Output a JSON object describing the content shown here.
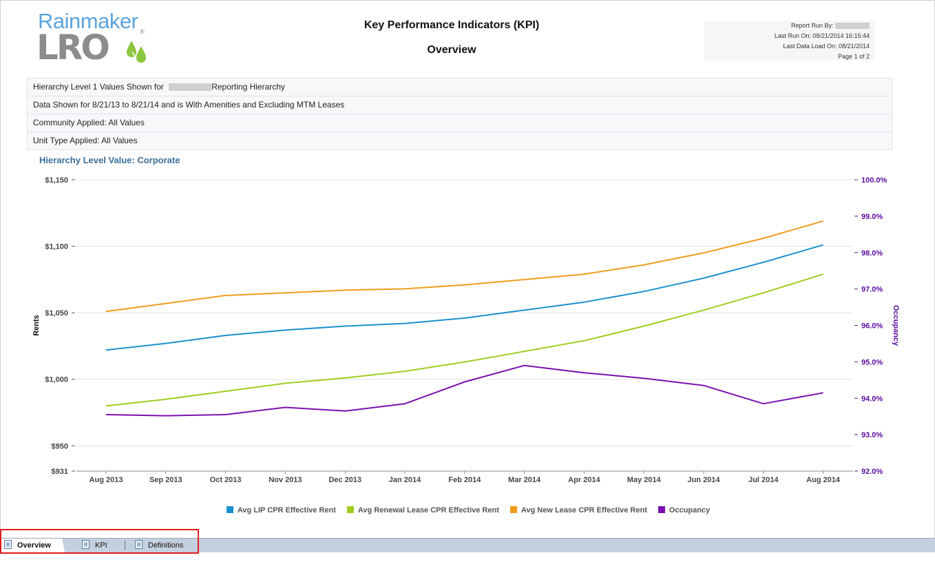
{
  "header": {
    "logo_top": "Rainmaker",
    "logo_bottom": "LRO",
    "logo_reg": "®",
    "title": "Key Performance Indicators (KPI)",
    "subtitle": "Overview",
    "report_run_by": "Report Run By:",
    "last_run_on": "Last Run On: 08/21/2014 16:15:44",
    "last_data_load": "Last Data Load On: 08/21/2014",
    "page": "Page 1 of 2"
  },
  "params": {
    "hierarchy_prefix": "Hierarchy Level 1 Values Shown for",
    "hierarchy_suffix": "Reporting Hierarchy",
    "data_shown": "Data Shown for 8/21/13 to 8/21/14 and is With Amenities and Excluding MTM Leases",
    "community": "Community Applied: All Values",
    "unit_type": "Unit Type Applied: All Values"
  },
  "hierarchy_value": "Hierarchy Level Value: Corporate",
  "chart_data": {
    "type": "line",
    "xlabel": "",
    "ylabel": "Rents",
    "y2label": "Occupancy",
    "categories": [
      "Aug 2013",
      "Sep 2013",
      "Oct 2013",
      "Nov 2013",
      "Dec 2013",
      "Jan 2014",
      "Feb 2014",
      "Mar 2014",
      "Apr 2014",
      "May 2014",
      "Jun 2014",
      "Jul 2014",
      "Aug 2014"
    ],
    "ylim": [
      931,
      1150
    ],
    "y_ticks": [
      931,
      950,
      1000,
      1050,
      1100,
      1150
    ],
    "y_tick_labels": [
      "$931",
      "$950",
      "$1,000",
      "$1,050",
      "$1,100",
      "$1,150"
    ],
    "y2lim": [
      92.0,
      100.0
    ],
    "y2_ticks": [
      92,
      93,
      94,
      95,
      96,
      97,
      98,
      99,
      100
    ],
    "y2_tick_labels": [
      "92.0%",
      "93.0%",
      "94.0%",
      "95.0%",
      "96.0%",
      "97.0%",
      "98.0%",
      "99.0%",
      "100.0%"
    ],
    "grid": true,
    "legend_position": "bottom",
    "series": [
      {
        "name": "Avg LIP CPR Effective Rent",
        "axis": "left",
        "color": "#1b8fce",
        "values": [
          1022,
          1027,
          1033,
          1037,
          1040,
          1042,
          1046,
          1052,
          1058,
          1066,
          1076,
          1088,
          1101
        ]
      },
      {
        "name": "Avg Renewal Lease CPR Effective Rent",
        "axis": "left",
        "color": "#9fcc1e",
        "values": [
          980,
          985,
          991,
          997,
          1001,
          1006,
          1013,
          1021,
          1029,
          1040,
          1052,
          1065,
          1079
        ]
      },
      {
        "name": "Avg New Lease CPR Effective Rent",
        "axis": "left",
        "color": "#ef9c1c",
        "values": [
          1051,
          1057,
          1063,
          1065,
          1067,
          1068,
          1071,
          1075,
          1079,
          1086,
          1095,
          1106,
          1119
        ]
      },
      {
        "name": "Occupancy",
        "axis": "right",
        "color": "#7a0fae",
        "values": [
          93.55,
          93.52,
          93.55,
          93.75,
          93.65,
          93.85,
          94.45,
          94.9,
          94.7,
          94.55,
          94.35,
          93.85,
          94.15
        ]
      }
    ]
  },
  "tabs": {
    "overview": "Overview",
    "kpi": "KPI",
    "definitions": "Definitions"
  }
}
